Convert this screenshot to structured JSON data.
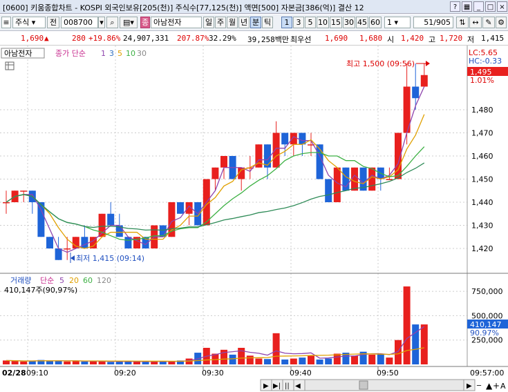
{
  "window": {
    "title": "[0600] 키움종합차트 - KOSPI 외국인보유[205(천)] 주식수[77,125(천)] 액면[500] 자본금[386(억)] 결산 12",
    "num_badge": "1"
  },
  "toolbar": {
    "market": "주식",
    "prev_label": "전",
    "code": "008700",
    "name": "아남전자",
    "name_badge": "종",
    "periods": [
      "일",
      "주",
      "월",
      "년",
      "분",
      "틱"
    ],
    "active_period": "분",
    "intervals": [
      "1",
      "3",
      "5",
      "10",
      "15",
      "30",
      "45",
      "60"
    ],
    "active_interval": "1",
    "interval_value": "1",
    "page": "51/905"
  },
  "quote": {
    "price": "1,690",
    "arrow": "▲",
    "change": "280",
    "pct": "+19.86%",
    "volume": "24,907,331",
    "vol_rate": "207.87%",
    "turnover": "32.29%",
    "amount": "39,258백만",
    "best_label": "최우선",
    "bid": "1,690",
    "ask": "1,680",
    "open_label": "시",
    "open": "1,420",
    "high_label": "고",
    "high": "1,720",
    "low_label": "저",
    "low": "1,415"
  },
  "chart": {
    "stock_label": "아남전자",
    "ma_label": "종가 단순",
    "ma_periods": [
      "1",
      "3",
      "5",
      "10",
      "30"
    ],
    "lc": "LC:5.65",
    "hc": "HC:-0.33",
    "high_annot": "최고 1,500 (09:56)",
    "low_annot": "최저 1,415 (09:14)",
    "current_price": "1,495",
    "current_pct": "1.01%",
    "volume_label": "거래량",
    "volume_ma": [
      "단순",
      "5",
      "20",
      "60",
      "120"
    ],
    "volume_now": "410,147주(90,97%)",
    "volume_tag": "410,147",
    "volume_tag_pct": "90.97%",
    "date": "02/28",
    "time_end": "09:57:00",
    "colors": {
      "up": "#e8201e",
      "down": "#1e64d8",
      "ma5": "#e0a000",
      "ma10": "#3cb043",
      "ma30": "#2e8b57",
      "ma3": "#8e44ad"
    }
  },
  "chart_data": {
    "type": "candlestick",
    "y_ticks": [
      1420,
      1430,
      1440,
      1450,
      1460,
      1470,
      1480
    ],
    "ylim": [
      1410,
      1505
    ],
    "x_ticks": [
      "09:10",
      "09:20",
      "09:30",
      "09:40",
      "09:50"
    ],
    "candles": [
      [
        1440,
        1445,
        1435,
        1440
      ],
      [
        1440,
        1445,
        1440,
        1445
      ],
      [
        1445,
        1445,
        1440,
        1445
      ],
      [
        1445,
        1445,
        1435,
        1440
      ],
      [
        1440,
        1440,
        1425,
        1425
      ],
      [
        1425,
        1425,
        1420,
        1420
      ],
      [
        1420,
        1425,
        1415,
        1415
      ],
      [
        1420,
        1425,
        1415,
        1420
      ],
      [
        1420,
        1425,
        1420,
        1425
      ],
      [
        1425,
        1430,
        1420,
        1420
      ],
      [
        1420,
        1425,
        1420,
        1425
      ],
      [
        1425,
        1435,
        1425,
        1435
      ],
      [
        1435,
        1440,
        1430,
        1430
      ],
      [
        1430,
        1435,
        1425,
        1425
      ],
      [
        1425,
        1425,
        1420,
        1420
      ],
      [
        1420,
        1425,
        1420,
        1425
      ],
      [
        1425,
        1425,
        1420,
        1420
      ],
      [
        1420,
        1430,
        1420,
        1430
      ],
      [
        1430,
        1430,
        1425,
        1425
      ],
      [
        1425,
        1440,
        1425,
        1440
      ],
      [
        1440,
        1440,
        1435,
        1435
      ],
      [
        1435,
        1440,
        1430,
        1440
      ],
      [
        1440,
        1440,
        1430,
        1430
      ],
      [
        1430,
        1450,
        1430,
        1450
      ],
      [
        1450,
        1455,
        1445,
        1455
      ],
      [
        1455,
        1460,
        1450,
        1460
      ],
      [
        1460,
        1460,
        1450,
        1450
      ],
      [
        1450,
        1455,
        1445,
        1455
      ],
      [
        1455,
        1460,
        1450,
        1455
      ],
      [
        1455,
        1465,
        1455,
        1465
      ],
      [
        1465,
        1465,
        1450,
        1455
      ],
      [
        1455,
        1475,
        1455,
        1470
      ],
      [
        1470,
        1470,
        1460,
        1465
      ],
      [
        1465,
        1470,
        1460,
        1470
      ],
      [
        1470,
        1470,
        1460,
        1465
      ],
      [
        1465,
        1470,
        1460,
        1465
      ],
      [
        1465,
        1465,
        1450,
        1450
      ],
      [
        1450,
        1450,
        1440,
        1440
      ],
      [
        1440,
        1455,
        1440,
        1455
      ],
      [
        1455,
        1455,
        1445,
        1445
      ],
      [
        1445,
        1455,
        1445,
        1455
      ],
      [
        1455,
        1455,
        1445,
        1445
      ],
      [
        1445,
        1455,
        1445,
        1455
      ],
      [
        1455,
        1455,
        1445,
        1450
      ],
      [
        1450,
        1455,
        1450,
        1450
      ],
      [
        1450,
        1470,
        1450,
        1470
      ],
      [
        1470,
        1500,
        1465,
        1490
      ],
      [
        1490,
        1500,
        1480,
        1485
      ],
      [
        1490,
        1500,
        1490,
        1495
      ]
    ],
    "volume_ticks": [
      250000,
      500000,
      750000
    ],
    "volume": [
      40000,
      35000,
      30000,
      35000,
      45000,
      35000,
      40000,
      30000,
      35000,
      30000,
      35000,
      30000,
      25000,
      30000,
      35000,
      30000,
      25000,
      30000,
      35000,
      30000,
      40000,
      60000,
      120000,
      170000,
      110000,
      150000,
      100000,
      170000,
      90000,
      60000,
      55000,
      320000,
      50000,
      60000,
      70000,
      90000,
      50000,
      60000,
      110000,
      120000,
      90000,
      130000,
      100000,
      110000,
      70000,
      250000,
      800000,
      410147,
      410147
    ]
  }
}
